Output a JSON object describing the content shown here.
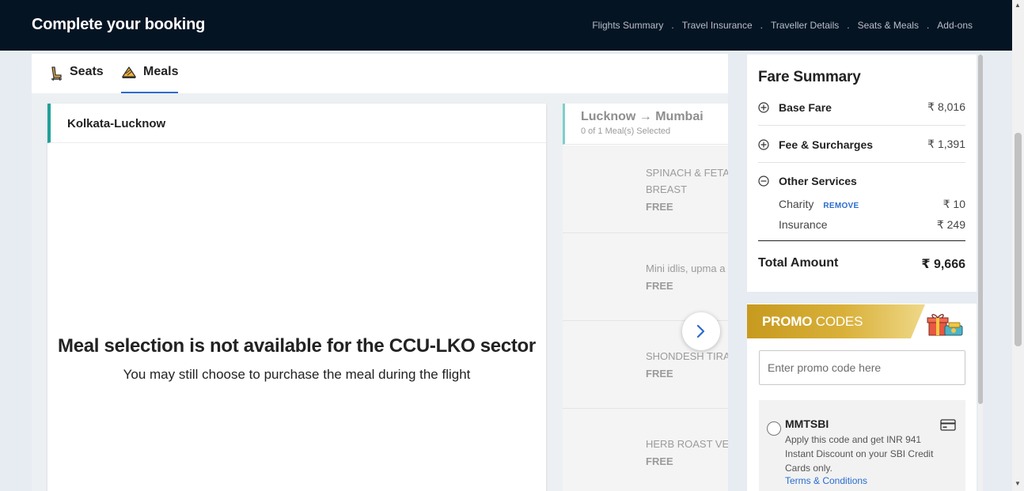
{
  "header": {
    "title": "Complete your booking",
    "steps": [
      "Flights Summary",
      "Travel Insurance",
      "Traveller Details",
      "Seats & Meals",
      "Add-ons"
    ],
    "separator": "."
  },
  "tabs": {
    "seats_label": "Seats",
    "meals_label": "Meals",
    "active": "Meals"
  },
  "sector": {
    "name": "Kolkata-Lucknow",
    "unavailable_title": "Meal selection is not available for the CCU-LKO sector",
    "unavailable_sub": "You may still choose to purchase the meal during the flight"
  },
  "next_sector": {
    "route": "Lucknow → Mumbai",
    "selected": "0 of 1 Meal(s) Selected",
    "meals": [
      {
        "name_line1": "SPINACH & FETA",
        "name_line2": "BREAST",
        "price": "FREE"
      },
      {
        "name_line1": "Mini idlis, upma a",
        "name_line2": "",
        "price": "FREE"
      },
      {
        "name_line1": "SHONDESH TIRA",
        "name_line2": "",
        "price": "FREE"
      },
      {
        "name_line1": "HERB ROAST VE",
        "name_line2": "",
        "price": "FREE"
      }
    ]
  },
  "fare_summary": {
    "title": "Fare Summary",
    "base_fare": {
      "label": "Base Fare",
      "value": "₹ 8,016"
    },
    "fees": {
      "label": "Fee & Surcharges",
      "value": "₹ 1,391"
    },
    "other": {
      "label": "Other Services"
    },
    "charity": {
      "label": "Charity",
      "action": "REMOVE",
      "value": "₹ 10"
    },
    "insurance": {
      "label": "Insurance",
      "value": "₹ 249"
    },
    "total": {
      "label": "Total Amount",
      "value": "₹ 9,666"
    }
  },
  "promo": {
    "title_bold": "PROMO",
    "title_rest": " CODES",
    "placeholder": "Enter promo code here",
    "coupon": {
      "code": "MMTSBI",
      "description": "Apply this code and get INR 941 Instant Discount on your SBI Credit Cards only.",
      "terms": "Terms & Conditions"
    }
  },
  "colors": {
    "header_bg": "#051423",
    "accent_blue": "#2a6ccf",
    "sector_accent": "#21a19a",
    "promo_gold": "#c79a1f"
  }
}
